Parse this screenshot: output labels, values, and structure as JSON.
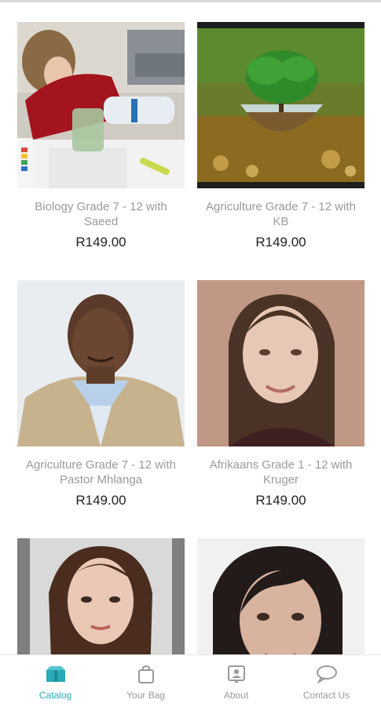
{
  "products": [
    {
      "title": "Biology Grade 7 - 12 with Saeed",
      "price": "R149.00",
      "image": "student-pouring-liquid-photo"
    },
    {
      "title": "Agriculture Grade 7 - 12 with KB",
      "price": "R149.00",
      "image": "tree-in-glass-bowl-photo"
    },
    {
      "title": "Agriculture Grade 7 - 12 with Pastor Mhlanga",
      "price": "R149.00",
      "image": "man-in-suit-portrait"
    },
    {
      "title": "Afrikaans Grade 1 - 12 with Kruger",
      "price": "R149.00",
      "image": "woman-portrait"
    },
    {
      "title": "",
      "price": "",
      "image": "young-woman-portrait"
    },
    {
      "title": "",
      "price": "",
      "image": "smiling-woman-portrait"
    }
  ],
  "tabbar": {
    "catalog": "Catalog",
    "bag": "Your Bag",
    "about": "About",
    "contact": "Contact Us"
  },
  "colors": {
    "accent": "#2aa9b8",
    "inactive": "#9a9a9a"
  }
}
